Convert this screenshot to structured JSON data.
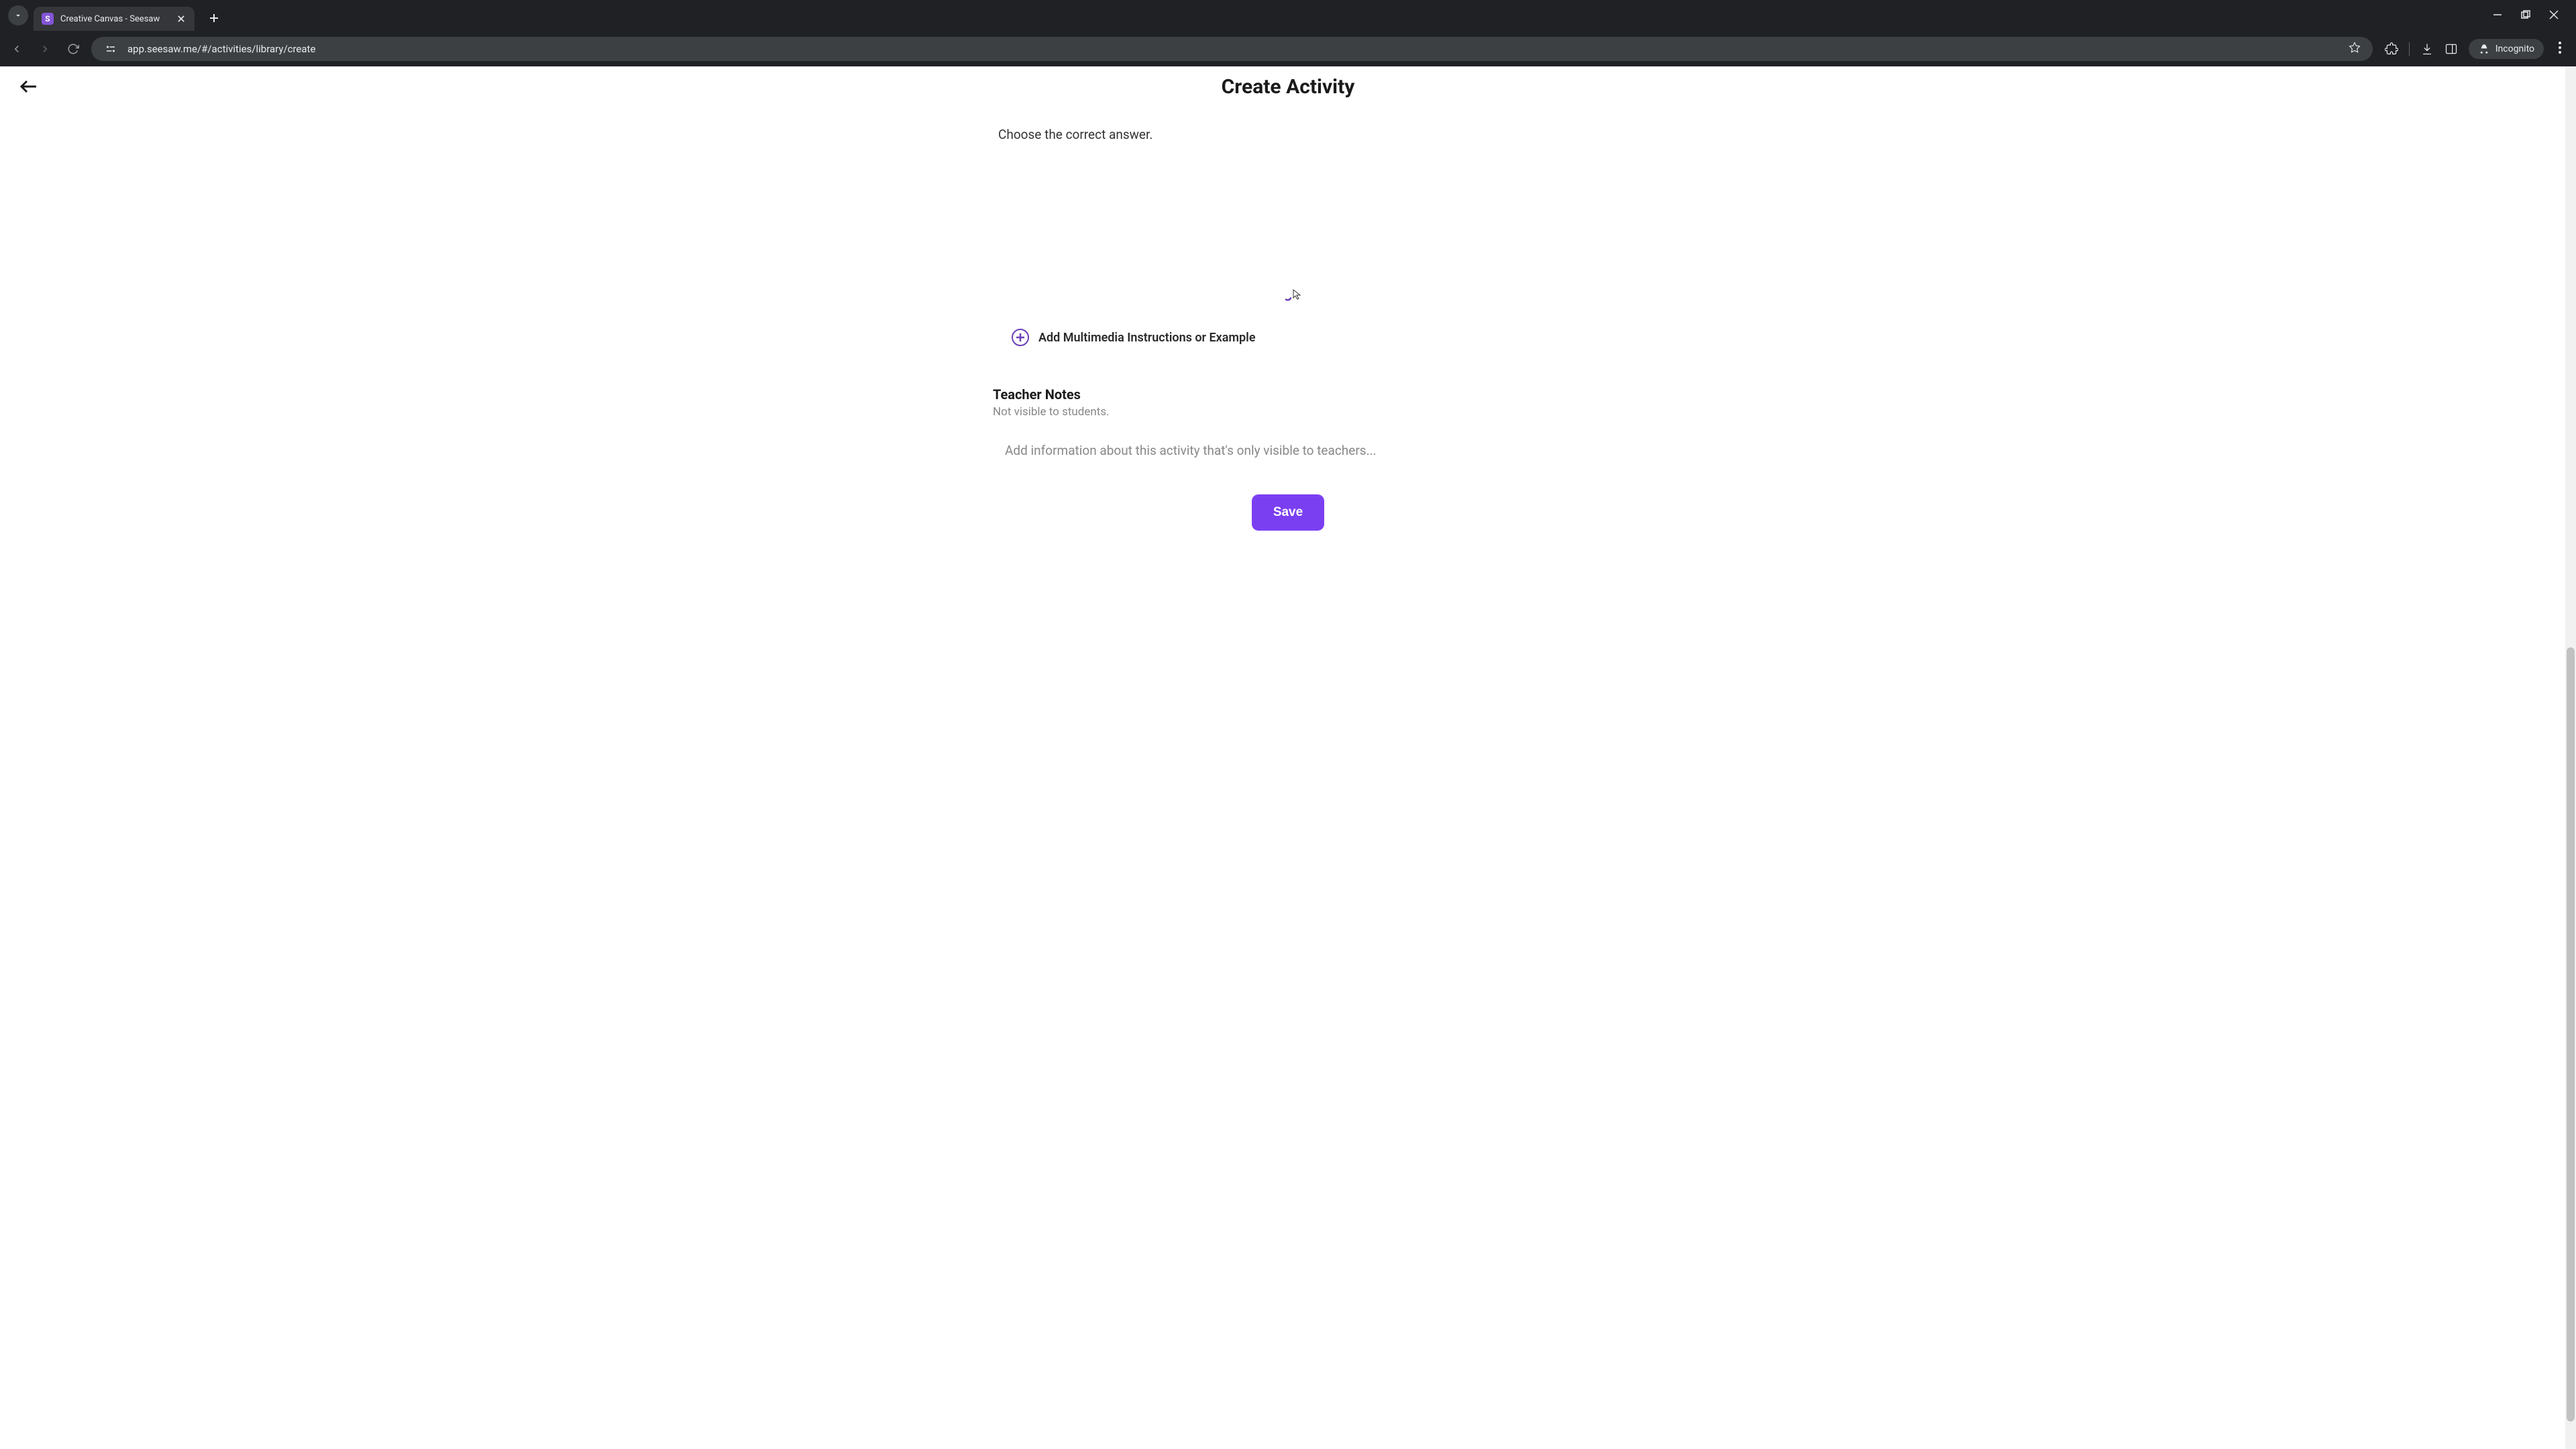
{
  "browser": {
    "tab_title": "Creative Canvas - Seesaw",
    "tab_favicon_letter": "S",
    "url": "app.seesaw.me/#/activities/library/create",
    "incognito_label": "Incognito"
  },
  "page": {
    "title": "Create Activity",
    "instruction_text": "Choose the correct answer.",
    "add_multimedia_label": "Add Multimedia Instructions or Example",
    "teacher_notes": {
      "heading": "Teacher Notes",
      "subtext": "Not visible to students.",
      "placeholder": "Add information about this activity that's only visible to teachers..."
    },
    "save_button_label": "Save"
  },
  "colors": {
    "accent": "#7b3ff2",
    "accent_dark": "#6b3fb8"
  }
}
